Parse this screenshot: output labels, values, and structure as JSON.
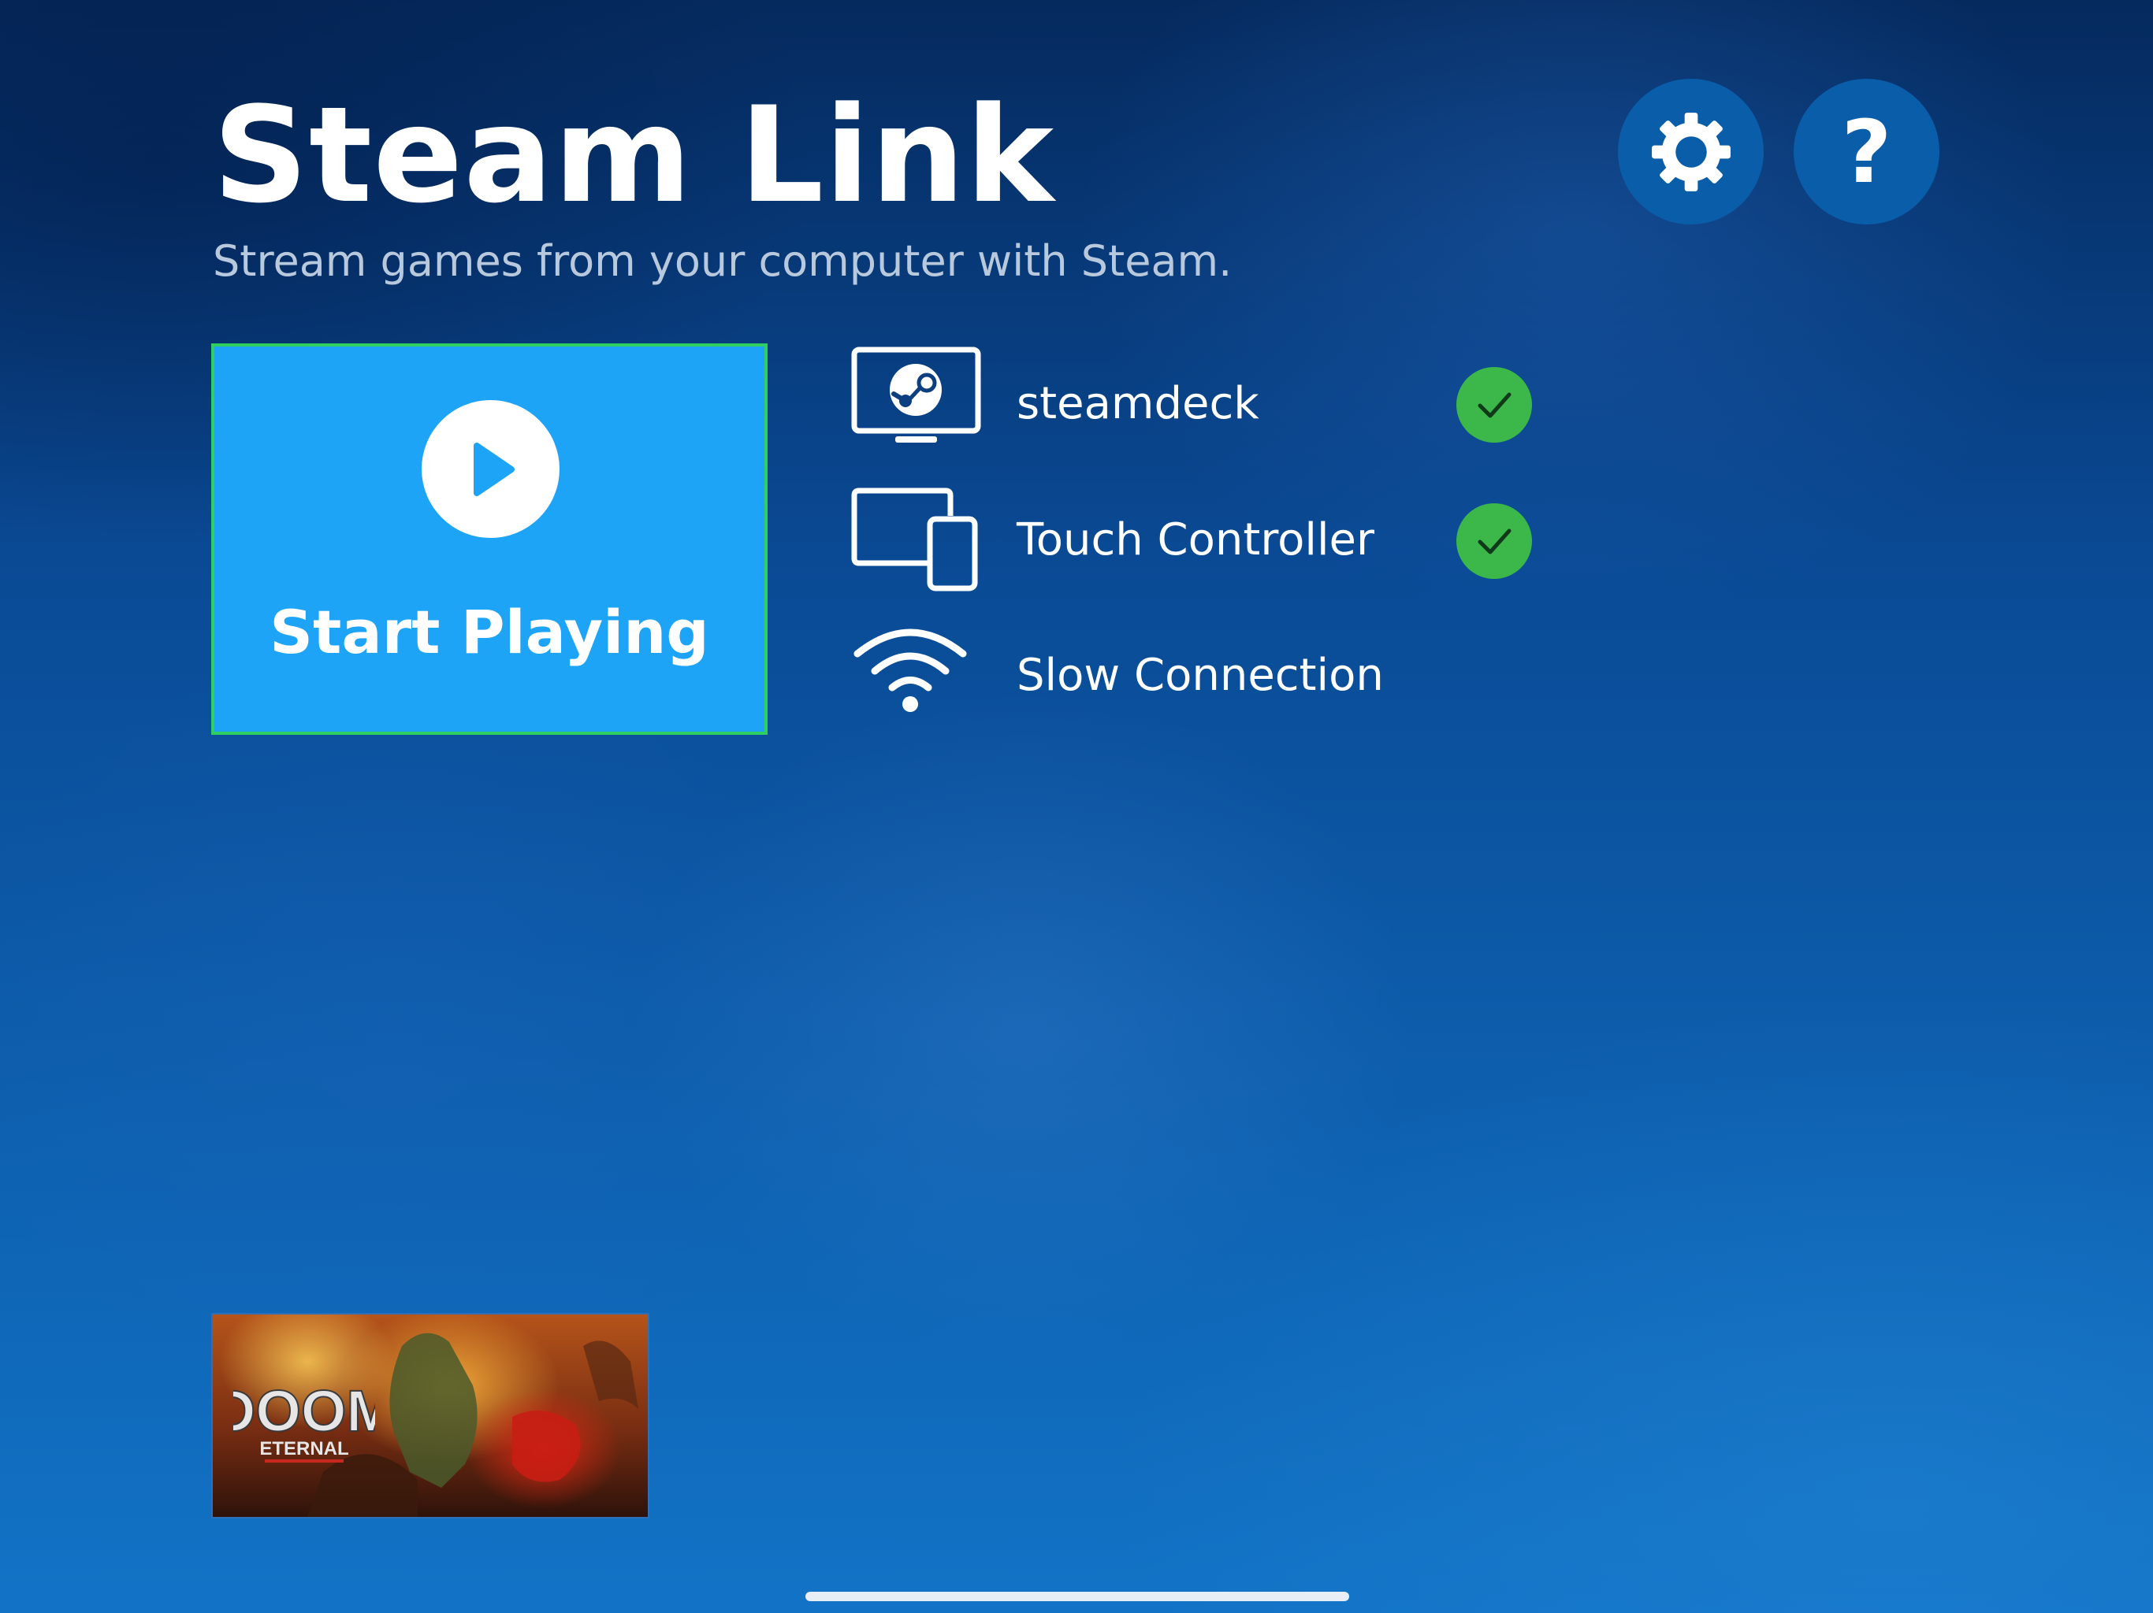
{
  "app": {
    "title": "Steam Link",
    "subtitle": "Stream games from your computer with Steam."
  },
  "toolbar": {
    "settings_icon": "gear-icon",
    "help_glyph": "?"
  },
  "start_tile": {
    "label": "Start Playing",
    "icon": "play-icon"
  },
  "status": [
    {
      "icon": "monitor-steam-icon",
      "label": "steamdeck",
      "ok": true
    },
    {
      "icon": "devices-icon",
      "label": "Touch Controller",
      "ok": true
    },
    {
      "icon": "wifi-icon",
      "label": "Slow Connection",
      "ok": false
    }
  ],
  "recent_game": {
    "logo_text": "DOOM",
    "logo_subtext": "ETERNAL"
  },
  "colors": {
    "tile": "#1da4f7",
    "tile_focus_border": "#2fd060",
    "check": "#3cb84a",
    "round_button": "#0a5da8"
  }
}
